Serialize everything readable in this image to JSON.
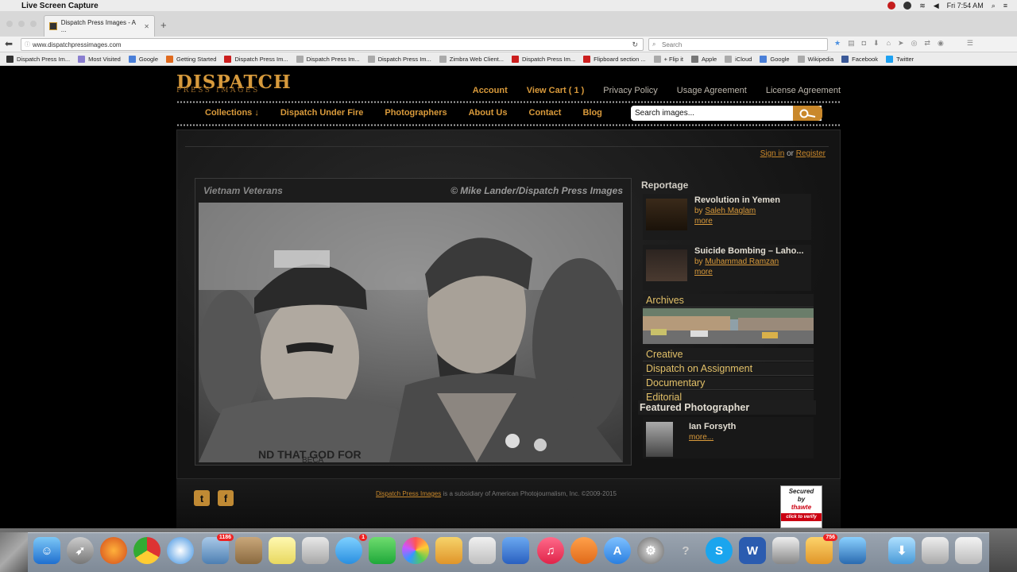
{
  "menubar": {
    "app_name": "Live Screen Capture",
    "clock": "Fri 7:54 AM"
  },
  "browser": {
    "tab_title": "Dispatch Press Images - A ...",
    "url": "www.dispatchpressimages.com",
    "search_placeholder": "Search",
    "bookmarks": [
      {
        "label": "Dispatch Press Im...",
        "color": "#333333"
      },
      {
        "label": "Most Visited",
        "color": "#8a7ed0"
      },
      {
        "label": "Google",
        "color": "#4a7fd8"
      },
      {
        "label": "Getting Started",
        "color": "#e06a1e"
      },
      {
        "label": "Dispatch Press Im...",
        "color": "#cc1f1f"
      },
      {
        "label": "Dispatch Press Im...",
        "color": "#aaaaaa"
      },
      {
        "label": "Dispatch Press Im...",
        "color": "#aaaaaa"
      },
      {
        "label": "Zimbra Web Client...",
        "color": "#aaaaaa"
      },
      {
        "label": "Dispatch Press Im...",
        "color": "#cc1f1f"
      },
      {
        "label": "Flipboard section ...",
        "color": "#cc1f1f"
      },
      {
        "label": "+ Flip it",
        "color": "#aaaaaa"
      },
      {
        "label": "Apple",
        "color": "#777777"
      },
      {
        "label": "iCloud",
        "color": "#aaaaaa"
      },
      {
        "label": "Google",
        "color": "#4a7fd8"
      },
      {
        "label": "Wikipedia",
        "color": "#aaaaaa"
      },
      {
        "label": "Facebook",
        "color": "#3b5998"
      },
      {
        "label": "Twitter",
        "color": "#1da1f2"
      }
    ]
  },
  "site": {
    "logo_line1": "DISPATCH",
    "logo_line2": "PRESS IMAGES",
    "toplinks": [
      {
        "label": "Account",
        "style": "gold"
      },
      {
        "label": "View Cart ( 1 )",
        "style": "gold"
      },
      {
        "label": "Privacy Policy",
        "style": "grey"
      },
      {
        "label": "Usage Agreement",
        "style": "grey"
      },
      {
        "label": "License Agreement",
        "style": "grey"
      }
    ],
    "nav": [
      "Collections ↓",
      "Dispatch Under Fire",
      "Photographers",
      "About Us",
      "Contact",
      "Blog"
    ],
    "search_placeholder": "Search images...",
    "signin": {
      "signin": "Sign in",
      "or": "or",
      "register": "Register"
    },
    "photo": {
      "title": "Vietnam Veterans",
      "credit": "© Mike Lander/Dispatch Press Images",
      "shirt_text": "ND THAT GOD FOR",
      "shirt_text2": "BECA"
    },
    "reportage": {
      "heading": "Reportage",
      "stories": [
        {
          "title": "Revolution in Yemen",
          "by": "by",
          "author": "Saleh Maglam",
          "more": "more"
        },
        {
          "title": "Suicide Bombing – Laho...",
          "by": "by",
          "author": "Muhammad Ramzan",
          "more": "more"
        }
      ]
    },
    "categories": [
      "Archives",
      "Creative",
      "Dispatch on Assignment",
      "Documentary",
      "Editorial"
    ],
    "featured": {
      "heading": "Featured Photographer",
      "name": "Ian Forsyth",
      "more": "more..."
    },
    "footer": {
      "brand": "Dispatch Press Images",
      "text": " is a subsidiary of American Photojournalism, Inc. ©2009-2015",
      "thawte_line1": "Secured",
      "thawte_line2": "by",
      "thawte_line3": "thawte",
      "thawte_verify": "click to verify"
    }
  },
  "dock": {
    "badges": {
      "photos": "1186",
      "messages": "1",
      "mail": "756"
    }
  },
  "colors": {
    "accent_gold": "#d99a3b",
    "background": "#000000"
  }
}
